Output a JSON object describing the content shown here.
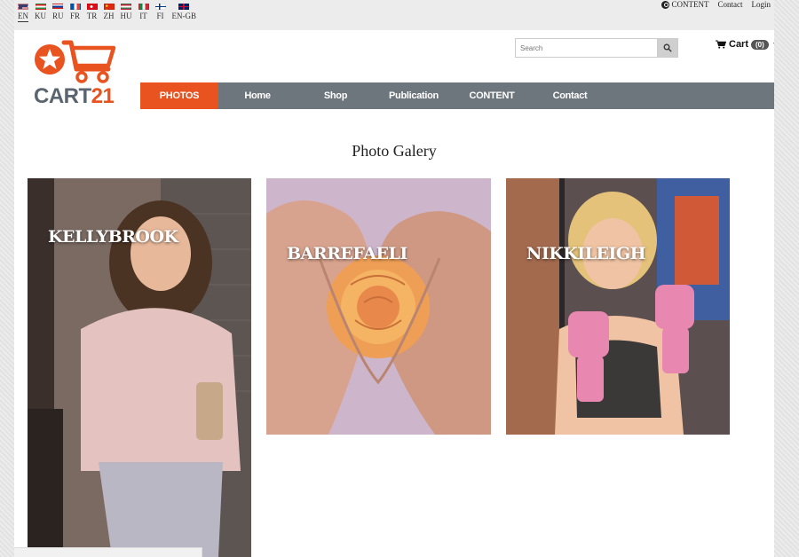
{
  "languages": [
    {
      "code": "EN",
      "flag": "us",
      "active": true
    },
    {
      "code": "KU",
      "flag": "ku",
      "active": false
    },
    {
      "code": "RU",
      "flag": "ru",
      "active": false
    },
    {
      "code": "FR",
      "flag": "fr",
      "active": false
    },
    {
      "code": "TR",
      "flag": "tr",
      "active": false
    },
    {
      "code": "ZH",
      "flag": "zh",
      "active": false
    },
    {
      "code": "HU",
      "flag": "hu",
      "active": false
    },
    {
      "code": "IT",
      "flag": "it",
      "active": false
    },
    {
      "code": "FI",
      "flag": "fi",
      "active": false
    },
    {
      "code": "EN-GB",
      "flag": "gb",
      "active": false
    }
  ],
  "toplinks": {
    "content": "CONTENT",
    "contact": "Contact",
    "login": "Login"
  },
  "logo": {
    "text_part1": "CART",
    "text_part2": "21",
    "icon": "cart-star-logo-icon"
  },
  "search": {
    "placeholder": "Search",
    "icon": "search-icon"
  },
  "cart": {
    "label": "Cart",
    "count": "(0)",
    "icon": "shopping-cart-icon"
  },
  "nav": {
    "items": [
      {
        "label": "PHOTOS",
        "active": true
      },
      {
        "label": "Home",
        "active": false
      },
      {
        "label": "Shop",
        "active": false
      },
      {
        "label": "Publication",
        "active": false
      },
      {
        "label": "CONTENT",
        "active": false
      },
      {
        "label": "Contact",
        "active": false
      }
    ]
  },
  "gallery": {
    "title": "Photo Galery",
    "cards": [
      {
        "caption": "KELLYBROOK"
      },
      {
        "caption": "BARREFAELI"
      },
      {
        "caption": "NIKKILEIGH"
      }
    ]
  },
  "colors": {
    "accent": "#e8531f",
    "nav_bg": "#6e767d",
    "logo_grey": "#5b6570"
  }
}
